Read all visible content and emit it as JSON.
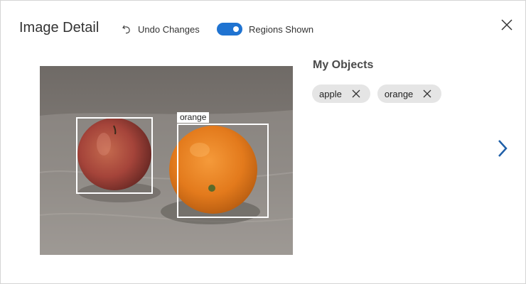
{
  "dialog": {
    "title": "Image Detail",
    "undo_label": "Undo Changes",
    "toggle_label": "Regions Shown",
    "toggle_on": true,
    "accent_color": "#1f73d1"
  },
  "image": {
    "regions": [
      {
        "label": ""
      },
      {
        "label": "orange"
      }
    ]
  },
  "objects": {
    "title": "My Objects",
    "tags": [
      {
        "label": "apple"
      },
      {
        "label": "orange"
      }
    ]
  },
  "icons": {
    "undo": "undo-arrow-icon",
    "close": "close-icon",
    "tag_remove": "close-icon",
    "next": "chevron-right-icon"
  }
}
